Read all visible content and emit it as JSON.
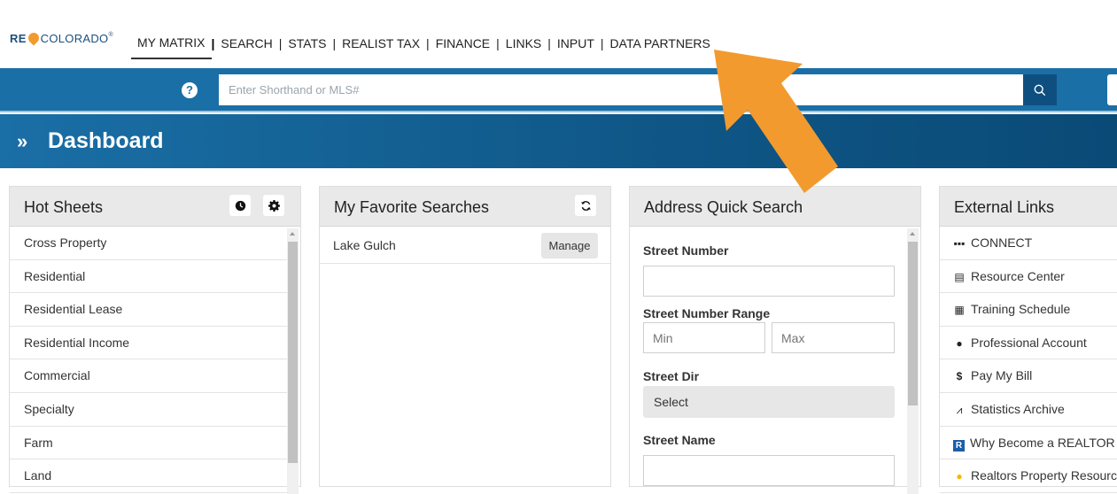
{
  "brand": {
    "re": "RE",
    "name": "COLORADO",
    "reg": "®"
  },
  "nav": {
    "items": [
      "MY MATRIX",
      "SEARCH",
      "STATS",
      "REALIST TAX",
      "FINANCE",
      "LINKS",
      "INPUT",
      "DATA PARTNERS"
    ],
    "active": "MY MATRIX",
    "separator": "|"
  },
  "search": {
    "help_label": "?",
    "placeholder": "Enter Shorthand or MLS#"
  },
  "dashboard": {
    "chevron": "»",
    "title": "Dashboard"
  },
  "hot_sheets": {
    "title": "Hot Sheets",
    "items": [
      "Cross Property",
      "Residential",
      "Residential Lease",
      "Residential Income",
      "Commercial",
      "Specialty",
      "Farm",
      "Land"
    ]
  },
  "favorites": {
    "title": "My Favorite Searches",
    "items": [
      {
        "name": "Lake Gulch",
        "button": "Manage"
      }
    ]
  },
  "address": {
    "title": "Address Quick Search",
    "street_number_label": "Street Number",
    "range_label": "Street Number Range",
    "min_placeholder": "Min",
    "max_placeholder": "Max",
    "dir_label": "Street Dir",
    "dir_value": "Select",
    "name_label": "Street Name"
  },
  "external_links": {
    "title": "External Links",
    "items": [
      {
        "icon": "grid-icon",
        "label": "CONNECT"
      },
      {
        "icon": "newspaper-icon",
        "label": "Resource Center"
      },
      {
        "icon": "calendar-icon",
        "label": "Training Schedule"
      },
      {
        "icon": "user-icon",
        "label": "Professional Account"
      },
      {
        "icon": "dollar-icon",
        "label": "Pay My Bill"
      },
      {
        "icon": "chart-icon",
        "label": "Statistics Archive"
      },
      {
        "icon": "realtor-icon",
        "label": "Why Become a REALTOR"
      },
      {
        "icon": "bulb-icon",
        "label": "Realtors Property Resource"
      }
    ]
  },
  "colors": {
    "header_blue": "#1a6fa6",
    "arrow_orange": "#f29a2e"
  }
}
